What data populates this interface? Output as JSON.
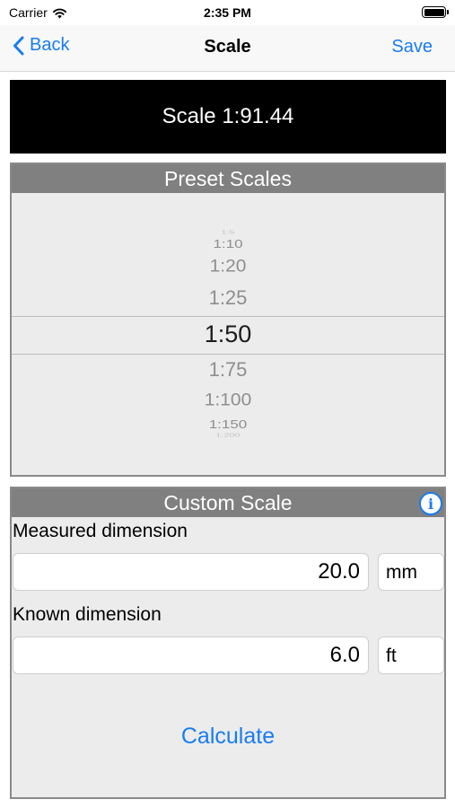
{
  "status_bar": {
    "carrier": "Carrier",
    "time": "2:35 PM",
    "wifi_icon": "wifi-icon",
    "battery_icon": "battery-icon"
  },
  "nav": {
    "back_label": "Back",
    "title": "Scale",
    "save_label": "Save",
    "back_icon": "chevron-left-icon"
  },
  "current_scale": "Scale 1:91.44",
  "preset": {
    "header": "Preset Scales",
    "items": [
      "1:5",
      "1:10",
      "1:20",
      "1:25",
      "1:50",
      "1:75",
      "1:100",
      "1:150",
      "1:200"
    ],
    "selected": "1:50"
  },
  "custom": {
    "header": "Custom Scale",
    "info_icon": "info-icon",
    "measured_label": "Measured dimension",
    "measured_value": "20.0",
    "measured_unit": "mm",
    "known_label": "Known dimension",
    "known_value": "6.0",
    "known_unit": "ft",
    "calculate_label": "Calculate"
  },
  "colors": {
    "accent": "#1a7cf0",
    "panel_header": "#808080",
    "banner": "#000000"
  }
}
